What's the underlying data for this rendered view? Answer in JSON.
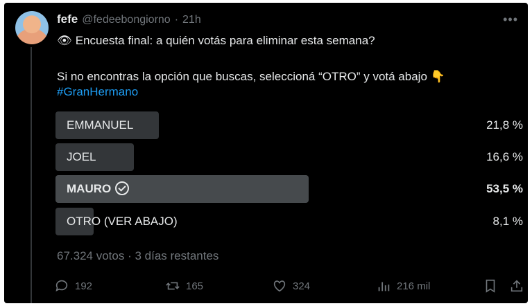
{
  "tweet": {
    "display_name": "fefe",
    "handle": "@fedeebongiorno",
    "separator": "·",
    "time": "21h",
    "more_icon": "more-horizontal-icon",
    "line1_emoji": "👁",
    "line1": "Encuesta final: a quién votás para eliminar esta semana?",
    "line2": "Si no encontras la opción que buscas, seleccioná “OTRO” y votá abajo 👇",
    "hashtag": "#GranHermano"
  },
  "poll": {
    "options": [
      {
        "label": "EMMANUEL",
        "percent": "21,8 %",
        "fraction": 0.218,
        "winner": false
      },
      {
        "label": "JOEL",
        "percent": "16,6 %",
        "fraction": 0.166,
        "winner": false
      },
      {
        "label": "MAURO",
        "percent": "53,5 %",
        "fraction": 0.535,
        "winner": true
      },
      {
        "label": "OTRO (VER ABAJO)",
        "percent": "8,1 %",
        "fraction": 0.081,
        "winner": false
      }
    ],
    "footer": "67.324 votos · 3 días restantes"
  },
  "actions": {
    "replies": "192",
    "retweets": "165",
    "likes": "324",
    "views": "216 mil"
  },
  "colors": {
    "background": "#000000",
    "text": "#e7e9ea",
    "muted": "#71767b",
    "link": "#1d9bf0",
    "bar": "#333639",
    "bar_winner": "#464a4d"
  }
}
